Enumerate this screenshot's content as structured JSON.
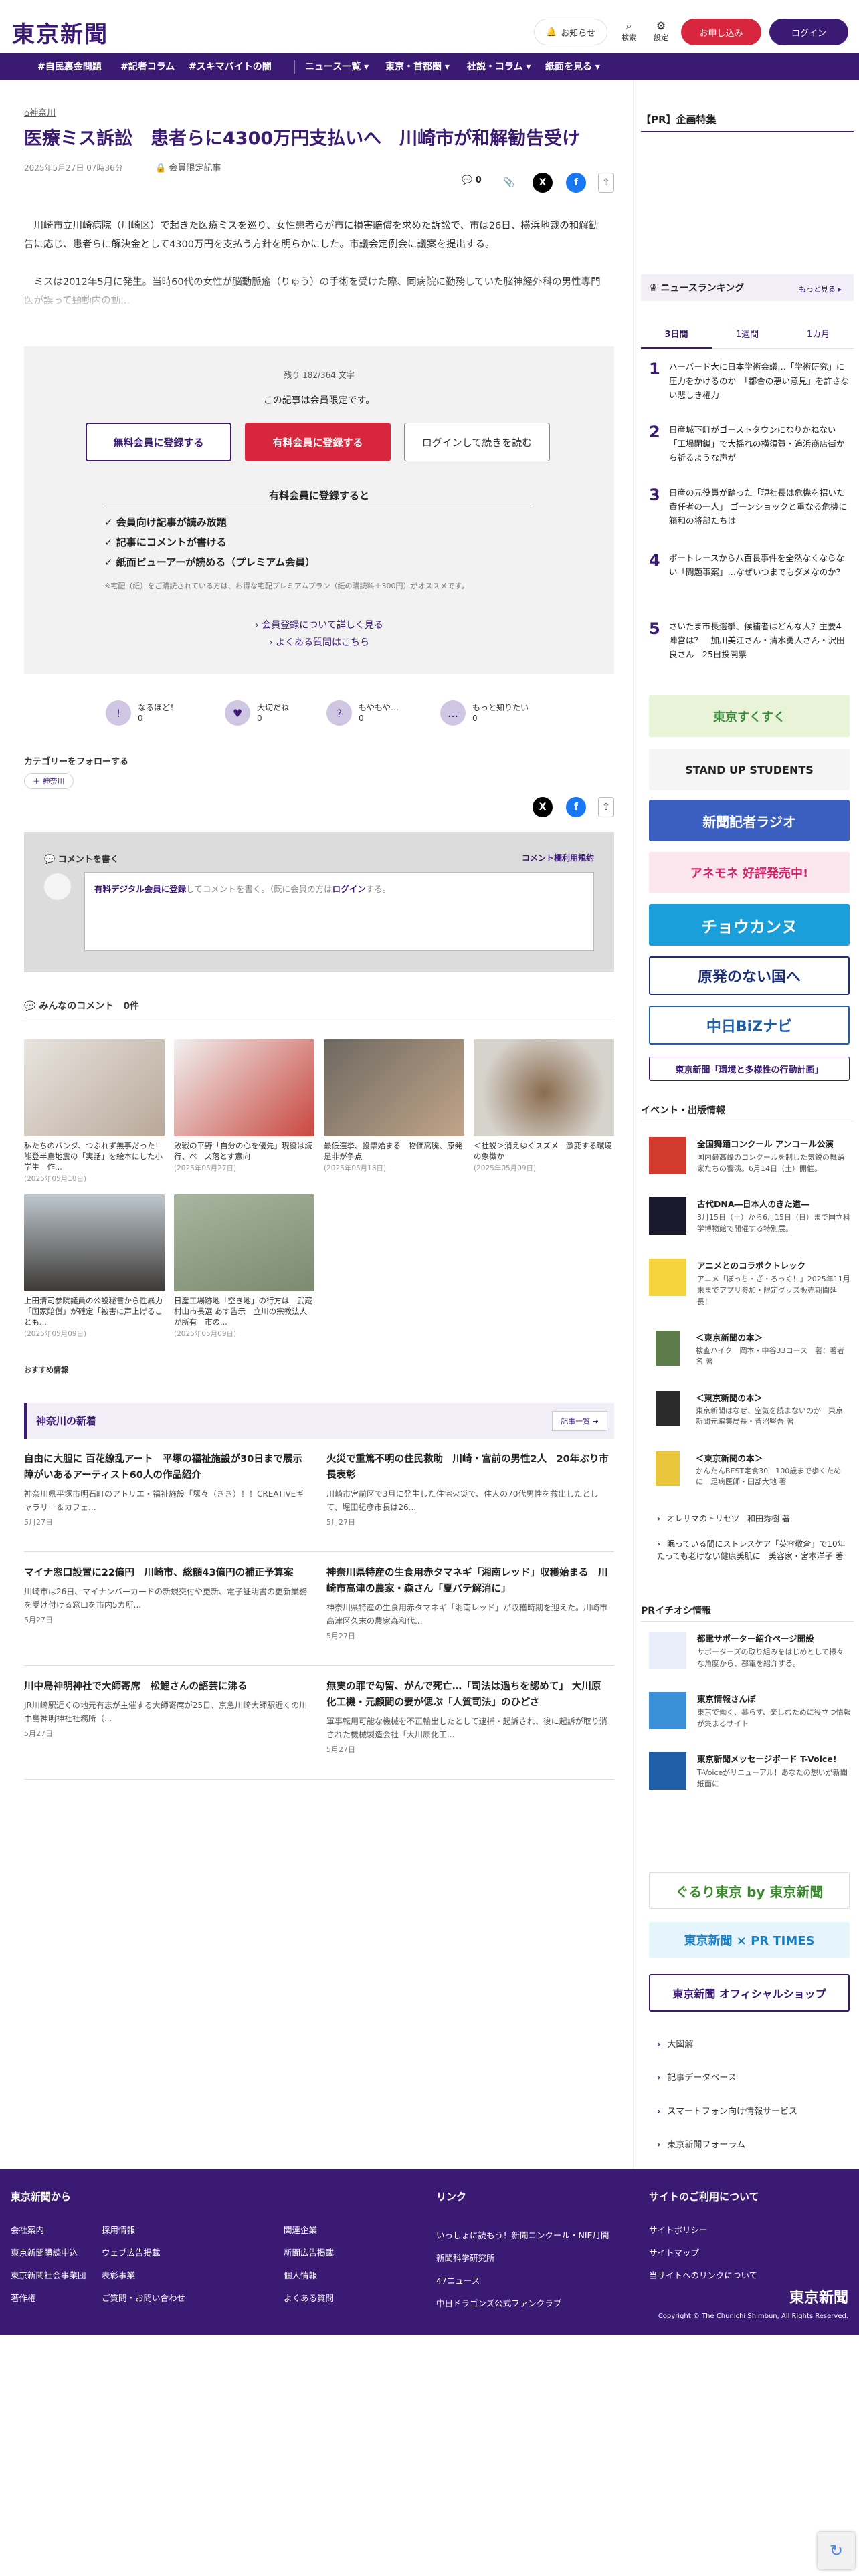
{
  "header": {
    "logo": "東京新聞",
    "notify": "お知らせ",
    "search": "検索",
    "settings": "設定",
    "trial": "お申し込み",
    "login": "ログイン"
  },
  "nav": [
    "#自民裏金問題",
    "#記者コラム",
    "#スキマバイトの闇",
    "ニュース一覧 ▾",
    "東京・首都圏 ▾",
    "社説・コラム ▾",
    "紙面を見る ▾"
  ],
  "article": {
    "prefecture": "神奈川",
    "title": "医療ミス訴訟　患者らに4300万円支払いへ　川崎市が和解勧告受け",
    "date": "2025年5月27日 07時36分",
    "members_only": "会員限定記事",
    "comment_count": "0",
    "p1": "川崎市立川崎病院（川崎区）で起きた医療ミスを巡り、女性患者らが市に損害賠償を求めた訴訟で、市は26日、横浜地裁の和解勧告に応じ、患者らに解決金として4300万円を支払う方針を明らかにした。市議会定例会に議案を提出する。",
    "p2": "ミスは2012年5月に発生。当時60代の女性が脳動脈瘤（りゅう）の手術を受けた際、同病院に勤務していた脳神経外科の男性専門医が誤って頸動内の動..."
  },
  "paywall": {
    "remaining": "残り 182/364 文字",
    "notice": "この記事は会員限定です。",
    "btn_free": "無料会員に登録する",
    "btn_paid": "有料会員に登録する",
    "btn_login": "ログインして続きを読む",
    "benefits_title": "有料会員に登録すると",
    "benefits": [
      "会員向け記事が読み放題",
      "記事にコメントが書ける",
      "紙面ビューアーが読める（プレミアム会員）"
    ],
    "note": "※宅配（紙）をご購読されている方は、お得な宅配プレミアムプラン（紙の購読料＋300円）がオススメです。",
    "link1": "会員登録について詳しく見る",
    "link2": "よくある質問はこちら"
  },
  "reactions": [
    {
      "icon": "!",
      "label": "なるほど！",
      "count": "0"
    },
    {
      "icon": "♥",
      "label": "大切だね",
      "count": "0"
    },
    {
      "icon": "?",
      "label": "もやもや…",
      "count": "0"
    },
    {
      "icon": "…",
      "label": "もっと知りたい",
      "count": "0"
    }
  ],
  "category": {
    "title": "カテゴリーをフォローする",
    "tag": "＋ 神奈川"
  },
  "comment": {
    "header": "コメントを書く",
    "rules": "コメント欄利用規約",
    "pre": "有料デジタル会員に登録",
    "mid": "してコメントを書く。（既に会員の方は",
    "login": "ログイン",
    "post": "する。"
  },
  "everyone": {
    "title": "みんなのコメント",
    "count": "0件"
  },
  "thumbs": [
    {
      "cap": "私たちのパンダ、つぶれず無事だった！　能登半島地震の「実話」を絵本にした小学生　作...",
      "date": "(2025年05月18日)"
    },
    {
      "cap": "敗戦の平野「自分の心を優先」現役は続行、ペース落とす意向",
      "date": "(2025年05月27日)"
    },
    {
      "cap": "最低選挙、投票始まる　物価高騰、原発是非が争点",
      "date": "(2025年05月18日)"
    },
    {
      "cap": "＜社説＞消えゆくスズメ　激変する環境の象徴か",
      "date": "(2025年05月09日)"
    },
    {
      "cap": "上田清司参院議員の公設秘書から性暴力「国家賠償」が確定「被害に声上げることも...",
      "date": "(2025年05月09日)"
    },
    {
      "cap": "日産工場跡地「空き地」の行方は　武蔵村山市長選 あす告示　立川の宗教法人が所有　市の...",
      "date": "(2025年05月09日)"
    }
  ],
  "recommend": "おすすめ情報",
  "kanagawa": {
    "title": "神奈川の新着",
    "more": "記事一覧 ➜"
  },
  "articles": [
    {
      "t": "自由に大胆に 百花繚乱アート　平塚の福祉施設が30日まで展示　障がいあるアーティスト60人の作品紹介",
      "b": "神奈川県平塚市明石町のアトリエ・福祉施設「塚々（きき）！！CREATIVEギャラリー＆カフェ...",
      "d": "5月27日"
    },
    {
      "t": "火災で重篤不明の住民救助　川崎・宮前の男性2人　20年ぶり市長表彰",
      "b": "川崎市宮前区で3月に発生した住宅火災で、住人の70代男性を救出したとして、堀田紀彦市長は26...",
      "d": "5月27日"
    },
    {
      "t": "マイナ窓口設置に22億円　川崎市、総額43億円の補正予算案",
      "b": "川崎市は26日、マイナンバーカードの新規交付や更新、電子証明書の更新業務を受け付ける窓口を市内5カ所...",
      "d": "5月27日"
    },
    {
      "t": "神奈川県特産の生食用赤タマネギ「湘南レッド」収穫始まる　川崎市高津の農家・森さん「夏バテ解消に」",
      "b": "神奈川県特産の生食用赤タマネギ「湘南レッド」が収穫時期を迎えた。川崎市高津区久末の農家森和代...",
      "d": "5月27日"
    },
    {
      "t": "川中島神明神社で大師寄席　松鯉さんの語芸に沸る",
      "b": "JR川崎駅近くの地元有志が主催する大師寄席が25日、京急川崎大師駅近くの川中島神明神社社務所（...",
      "d": "5月27日"
    },
    {
      "t": "無実の罪で勾留、がんで死亡…「司法は過ちを認めて」 大川原化工機・元顧問の妻が偲ぶ「人質司法」のひどさ",
      "b": "軍事転用可能な機械を不正輸出したとして逮捕・起訴され、後に起訴が取り消された機械製造会社「大川原化工...",
      "d": "5月27日"
    }
  ],
  "side": {
    "pr": "【PR】企画特集",
    "ranking_title": "ニュースランキング",
    "ranking_more": "もっと見る ▸",
    "tabs": [
      "3日間",
      "1週間",
      "1カ月"
    ],
    "ranking": [
      {
        "n": "1",
        "t": "ハーバード大に日本学術会議…「学術研究」に圧力をかけるのか　「都合の悪い意見」を許さない悲しき権力"
      },
      {
        "n": "2",
        "t": "日産城下町がゴーストタウンになりかねない「工場閉鎖」で大揺れの横須賀・追浜商店街から祈るような声が"
      },
      {
        "n": "3",
        "t": "日産の元役員が踏った「現社長は危機を招いた責任者の一人」 ゴーンショックと重なる危機に箱和の将部たちは"
      },
      {
        "n": "4",
        "t": "ボートレースから八百長事件を全然なくならない「問題事案」…なぜいつまでもダメなのか？"
      },
      {
        "n": "5",
        "t": "さいたま市長選挙、候補者はどんな人？主要4陣営は？　加川美江さん・清水勇人さん・沢田良さん　25日投開票"
      }
    ],
    "banners": [
      {
        "text": "東京すくすく",
        "bg": "#e8f3d8",
        "fg": "#3b8a3e"
      },
      {
        "text": "STAND UP STUDENTS",
        "bg": "#f5f5f5",
        "fg": "#222"
      },
      {
        "text": "新聞記者ラジオ",
        "bg": "#3b5fc0",
        "fg": "#fff"
      },
      {
        "text": "アネモネ 好評発売中!",
        "bg": "#fbe6ee",
        "fg": "#d1236a"
      },
      {
        "text": "チョウカンヌ",
        "bg": "#1a9fdb",
        "fg": "#fff"
      },
      {
        "text": "原発のない国へ",
        "bg": "#fff",
        "fg": "#1e2f7a"
      },
      {
        "text": "中日BiZナビ",
        "bg": "#fff",
        "fg": "#1e5fa8"
      },
      {
        "text": "東京新聞「環境と多様性の行動計画」",
        "bg": "#fff",
        "fg": "#3a1a73"
      }
    ],
    "events_title": "イベント・出版情報",
    "events": [
      {
        "t": "全国舞踊コンクール アンコール公演",
        "s": "国内最高峰のコンクールを制した気鋭の舞踊家たちの饗演。6月14日（土）開催。",
        "bg": "#d23a2e"
      },
      {
        "t": "古代DNA―日本人のきた道―",
        "s": "3月15日（土）から6月15日（日）まで国立科学博物館で開催する特別展。",
        "bg": "#1a1a2e"
      },
      {
        "t": "アニメとのコラボクトレック",
        "s": "アニメ「ぼっち・ざ・ろっく！」2025年11月末までアプリ参加・限定グッズ販売期間延長！",
        "bg": "#f4d33b"
      }
    ],
    "books": [
      {
        "t": "＜東京新聞の本＞",
        "s": "検査ハイク　岡本・中谷33コース　著：著者名 著",
        "bg": "#5c7c4a"
      },
      {
        "t": "＜東京新聞の本＞",
        "s": "東京新聞はなぜ、空気を読まないのか　東京新聞元編集局長・菅沼堅吾 著",
        "bg": "#2b2b2b"
      },
      {
        "t": "＜東京新聞の本＞",
        "s": "かんたんBEST定食30　100歳まで歩くために　足病医師・田部大地 著",
        "bg": "#e9c53b"
      }
    ],
    "book_links": [
      "オレサマのトリセツ　和田秀樹 著",
      "眠っている間にストレスケア「英容敬倉」で10年たっても老けない健康美肌に　美容家・宮本洋子 著"
    ],
    "pr2_title": "PRイチオシ情報",
    "pr2": [
      {
        "t": "都電サポーター紹介ページ開設",
        "s": "サポーターズの取り組みをはじめとして様々な角度から、都電を紹介する。",
        "bg": "#e7eef9"
      },
      {
        "t": "東京情報さんぽ",
        "s": "東京で働く、暮らす、楽しむために役立つ情報が集まるサイト",
        "bg": "#3a8fd8"
      },
      {
        "t": "東京新聞メッセージボード T-Voice!",
        "s": "T-Voiceがリニューアル！あなたの想いが新聞紙面に",
        "bg": "#1e5fa8"
      }
    ],
    "logos": [
      {
        "text": "ぐるり東京 by 東京新聞",
        "bg": "#fff",
        "fg": "#3a8a2e"
      },
      {
        "text": "東京新聞 × PR TIMES",
        "bg": "#e6f4fb",
        "fg": "#1a7ec1"
      },
      {
        "text": "東京新聞 オフィシャルショップ",
        "bg": "#fff",
        "fg": "#3a1a73"
      }
    ],
    "links": [
      "大図解",
      "記事データベース",
      "スマートフォン向け情報サービス",
      "東京新聞フォーラム"
    ]
  },
  "footer": {
    "col1_title": "東京新聞から",
    "col1": [
      "会社案内",
      "採用情報",
      "関連企業",
      "東京新聞購読申込",
      "ウェブ広告掲載",
      "新聞広告掲載",
      "東京新聞社会事業団",
      "表彰事業",
      "個人情報",
      "著作権",
      "ご質問・お問い合わせ",
      "よくある質問"
    ],
    "col2_title": "リンク",
    "col2": [
      "いっしょに読もう！新聞コンクール・NIE月間",
      "新聞科学研究所",
      "47ニュース",
      "中日ドラゴンズ公式ファンクラブ"
    ],
    "col3_title": "サイトのご利用について",
    "col3": [
      "サイトポリシー",
      "サイトマップ",
      "当サイトへのリンクについて"
    ],
    "logo": "東京新聞",
    "copyright": "Copyright © The Chunichi Shimbun, All Rights Reserved."
  }
}
